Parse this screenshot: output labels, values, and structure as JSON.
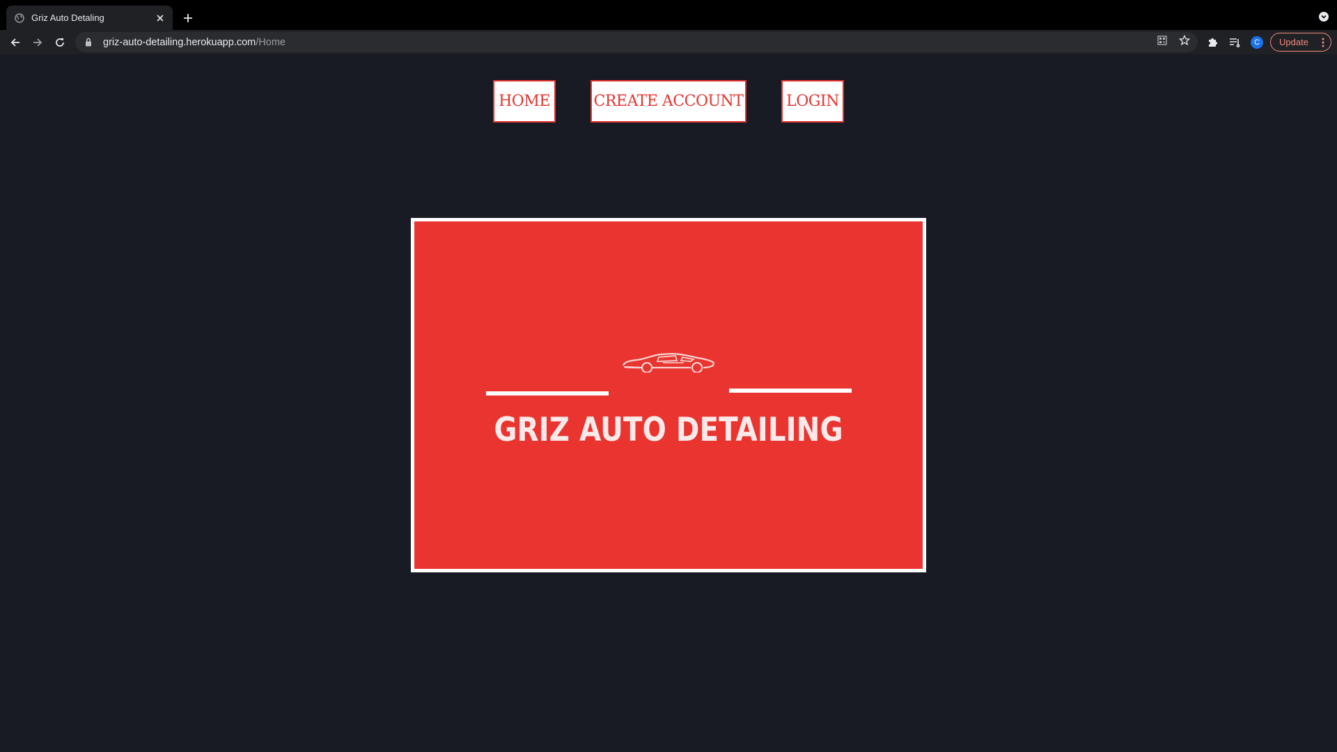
{
  "browser": {
    "tab_title": "Griz Auto Detaling",
    "url_host": "griz-auto-detailing.herokuapp.com",
    "url_path": "/Home",
    "profile_initial": "C",
    "update_label": "Update"
  },
  "nav": {
    "home": "HOME",
    "create_account": "CREATE ACCOUNT",
    "login": "LOGIN"
  },
  "hero": {
    "title": "GRIZ AUTO DETAILING"
  },
  "colors": {
    "page_bg": "#181b23",
    "brand_red": "#e93430",
    "nav_text": "#e8322d"
  },
  "icons": {
    "car_logo": "car-logo-icon"
  }
}
